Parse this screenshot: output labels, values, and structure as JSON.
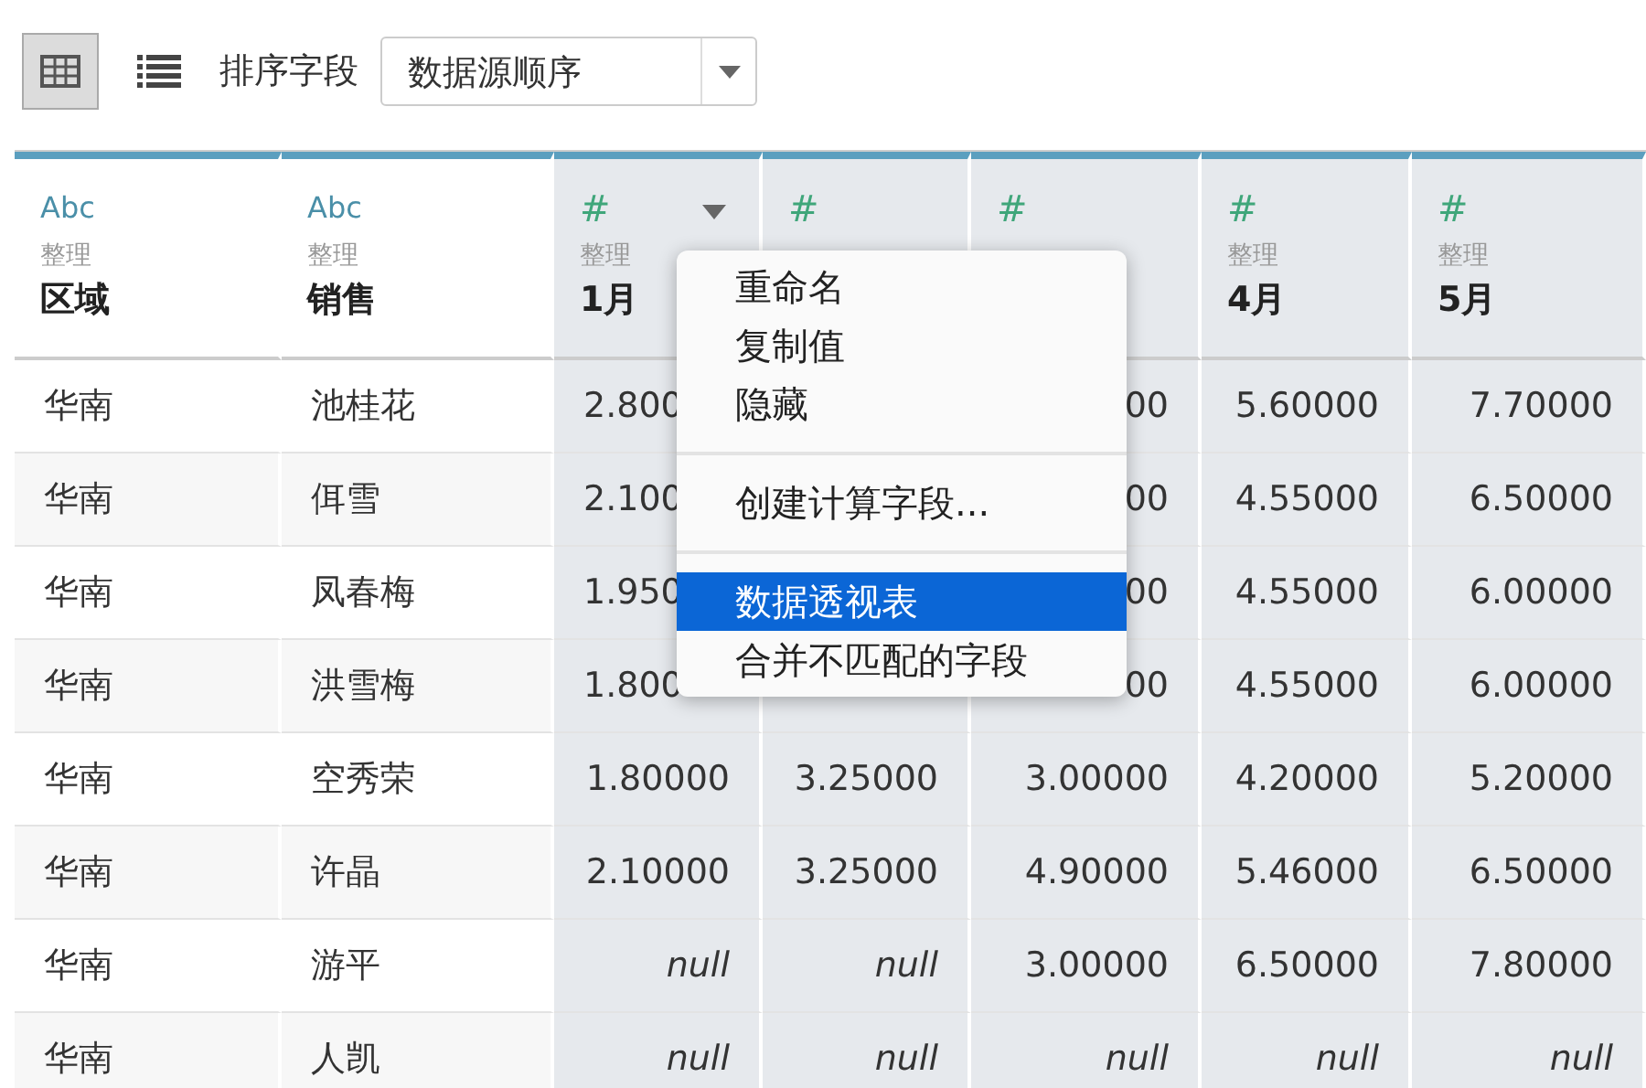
{
  "toolbar": {
    "views": [
      {
        "kind": "grid",
        "selected": true
      },
      {
        "kind": "list",
        "selected": false
      }
    ],
    "sort_label": "排序字段",
    "sort_value": "数据源顺序"
  },
  "columns": [
    {
      "type_label": "Abc",
      "kind": "text",
      "subtitle": "整理",
      "name": "区域"
    },
    {
      "type_label": "Abc",
      "kind": "text",
      "subtitle": "整理",
      "name": "销售"
    },
    {
      "type_label": "#",
      "kind": "number",
      "subtitle": "整理",
      "name": "1月",
      "menu_open": true
    },
    {
      "type_label": "#",
      "kind": "number"
    },
    {
      "type_label": "#",
      "kind": "number"
    },
    {
      "type_label": "#",
      "kind": "number",
      "subtitle": "整理",
      "name": "4月"
    },
    {
      "type_label": "#",
      "kind": "number",
      "subtitle": "整理",
      "name": "5月"
    }
  ],
  "rows": [
    [
      {
        "text": "华南"
      },
      {
        "text": "池桂花"
      },
      {
        "text": "2.800",
        "kind": "cut"
      },
      null,
      {
        "text": "00"
      },
      {
        "text": "5.60000"
      },
      {
        "text": "7.70000"
      }
    ],
    [
      {
        "text": "华南"
      },
      {
        "text": "佴雪"
      },
      {
        "text": "2.100",
        "kind": "cut"
      },
      null,
      {
        "text": "00"
      },
      {
        "text": "4.55000"
      },
      {
        "text": "6.50000"
      }
    ],
    [
      {
        "text": "华南"
      },
      {
        "text": "凤春梅"
      },
      {
        "text": "1.950",
        "kind": "cut"
      },
      null,
      {
        "text": "00"
      },
      {
        "text": "4.55000"
      },
      {
        "text": "6.00000"
      }
    ],
    [
      {
        "text": "华南"
      },
      {
        "text": "洪雪梅"
      },
      {
        "text": "1.800",
        "kind": "cut"
      },
      {
        "kind": "blank"
      },
      {
        "text": "00"
      },
      {
        "text": "4.55000"
      },
      {
        "text": "6.00000"
      }
    ],
    [
      {
        "text": "华南"
      },
      {
        "text": "空秀荣"
      },
      {
        "text": "1.80000"
      },
      {
        "text": "3.25000"
      },
      {
        "text": "3.00000"
      },
      {
        "text": "4.20000"
      },
      {
        "text": "5.20000"
      }
    ],
    [
      {
        "text": "华南"
      },
      {
        "text": "许晶"
      },
      {
        "text": "2.10000"
      },
      {
        "text": "3.25000"
      },
      {
        "text": "4.90000"
      },
      {
        "text": "5.46000"
      },
      {
        "text": "6.50000"
      }
    ],
    [
      {
        "text": "华南"
      },
      {
        "text": "游平"
      },
      {
        "text": "null",
        "kind": "null"
      },
      {
        "text": "null",
        "kind": "null"
      },
      {
        "text": "3.00000"
      },
      {
        "text": "6.50000"
      },
      {
        "text": "7.80000"
      }
    ],
    [
      {
        "text": "华南"
      },
      {
        "text": "人凯"
      },
      {
        "text": "null",
        "kind": "null"
      },
      {
        "text": "null",
        "kind": "null"
      },
      {
        "text": "null",
        "kind": "null"
      },
      {
        "text": "null",
        "kind": "null"
      },
      {
        "text": "null",
        "kind": "null"
      }
    ]
  ],
  "context_menu": {
    "groups": [
      [
        {
          "label": "重命名",
          "selected": false
        },
        {
          "label": "复制值",
          "selected": false
        },
        {
          "label": "隐藏",
          "selected": false
        }
      ],
      [
        {
          "label": "创建计算字段...",
          "selected": false
        }
      ],
      [
        {
          "label": "数据透视表",
          "selected": true
        },
        {
          "label": "合并不匹配的字段",
          "selected": false
        }
      ]
    ]
  }
}
